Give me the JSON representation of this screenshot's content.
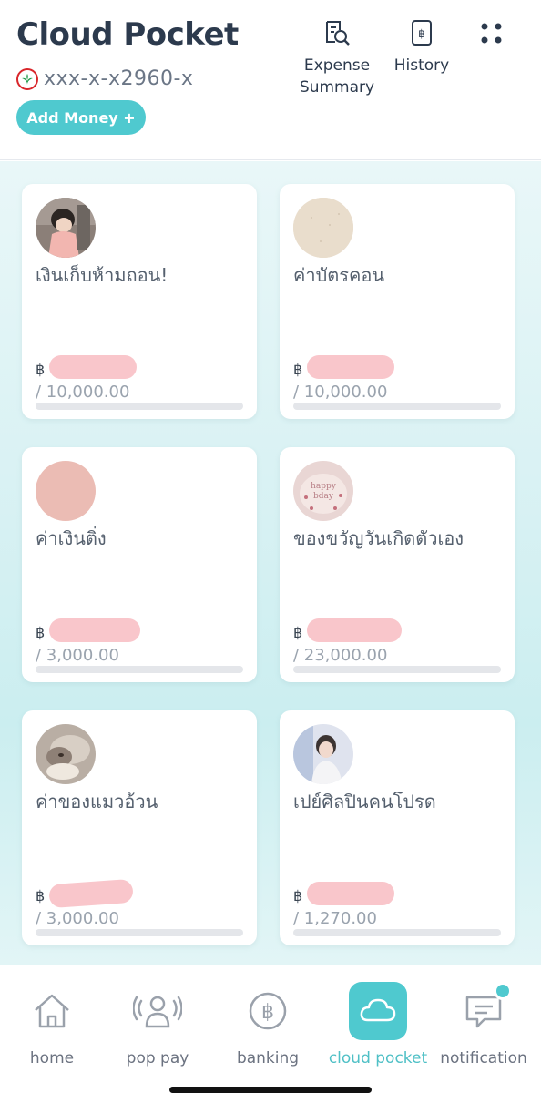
{
  "header": {
    "title": "Cloud Pocket",
    "account_number": "xxx-x-x2960-x",
    "add_money_label": "Add Money +",
    "expense_summary_label": "Expense Summary",
    "history_label": "History",
    "icons": {
      "expense": "receipt-search-icon",
      "history": "baht-book-icon",
      "more": "more-dots-icon",
      "bank": "kasikorn-logo-icon"
    }
  },
  "colors": {
    "accent": "#4fc9cf",
    "redaction": "#f9c6cb",
    "title": "#2c3a4d"
  },
  "pockets": [
    {
      "name": "เงินเก็บห้ามถอน!",
      "currency": "฿",
      "target": "/ 10,000.00",
      "progress": 0,
      "image": "girl-illustration-avatar"
    },
    {
      "name": "ค่าบัตรคอน",
      "currency": "฿",
      "target": "/ 10,000.00",
      "progress": 0,
      "image": "beige-texture-avatar"
    },
    {
      "name": "ค่าเงินติ่ง",
      "currency": "฿",
      "target": "/ 3,000.00",
      "progress": 0,
      "image": "pink-solid-avatar"
    },
    {
      "name": "ของขวัญวันเกิดตัวเอง",
      "currency": "฿",
      "target": "/ 23,000.00",
      "progress": 0,
      "image": "birthday-cake-avatar"
    },
    {
      "name": "ค่าของแมวอ้วน",
      "currency": "฿",
      "target": "/ 3,000.00",
      "progress": 0,
      "image": "cat-photo-avatar"
    },
    {
      "name": "เปย์ศิลปินคนโปรด",
      "currency": "฿",
      "target": "/ 1,270.00",
      "progress": 0,
      "image": "artist-photo-avatar"
    }
  ],
  "nav": {
    "items": [
      {
        "label": "home",
        "icon": "home-icon",
        "active": false
      },
      {
        "label": "pop pay",
        "icon": "pop-pay-icon",
        "active": false
      },
      {
        "label": "banking",
        "icon": "baht-coin-icon",
        "active": false
      },
      {
        "label": "cloud pocket",
        "icon": "cloud-icon",
        "active": true
      },
      {
        "label": "notification",
        "icon": "message-icon",
        "active": false
      }
    ]
  }
}
